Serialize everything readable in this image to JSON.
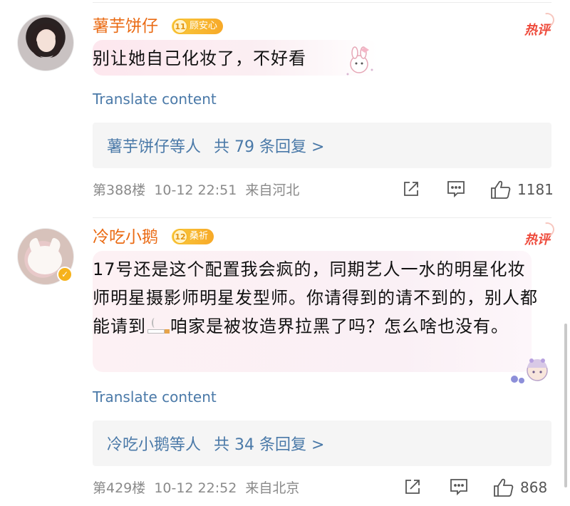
{
  "comments": [
    {
      "username": "薯芋饼仔",
      "fan_level": "11",
      "fan_name": "顾安心",
      "hot_label": "热评",
      "text": "别让她自己化妆了，不好看",
      "translate_label": "Translate content",
      "reply_names": "薯芋饼仔等人",
      "reply_summary": "共 79 条回复 >",
      "floor": "第388楼",
      "datetime": "10-12 22:51",
      "location": "来自河北",
      "likes": "1181",
      "verified": false
    },
    {
      "username": "冷吃小鹅",
      "fan_level": "12",
      "fan_name": "桑祈",
      "hot_label": "热评",
      "text_part1": "17号还是这个配置我会疯的，同期艺人一水的明星化妆师明星摄影师明星发型师。你请得到的请不到的，别人都能请到",
      "text_part2": "咱家是被妆造界拉黑了吗？怎么啥也没有。",
      "translate_label": "Translate content",
      "reply_names": "冷吃小鹅等人",
      "reply_summary": "共 34 条回复 >",
      "floor": "第429楼",
      "datetime": "10-12 22:52",
      "location": "来自北京",
      "likes": "868",
      "verified": true
    }
  ],
  "colors": {
    "username": "#ea6b14",
    "link": "#4a79a8",
    "hot": "#ee4b3c",
    "meta": "#8a8a8a"
  },
  "icons": {
    "share": "share-icon",
    "comment": "comment-icon",
    "like": "thumbs-up-icon",
    "smoke": "cigarette-emoji-icon"
  }
}
